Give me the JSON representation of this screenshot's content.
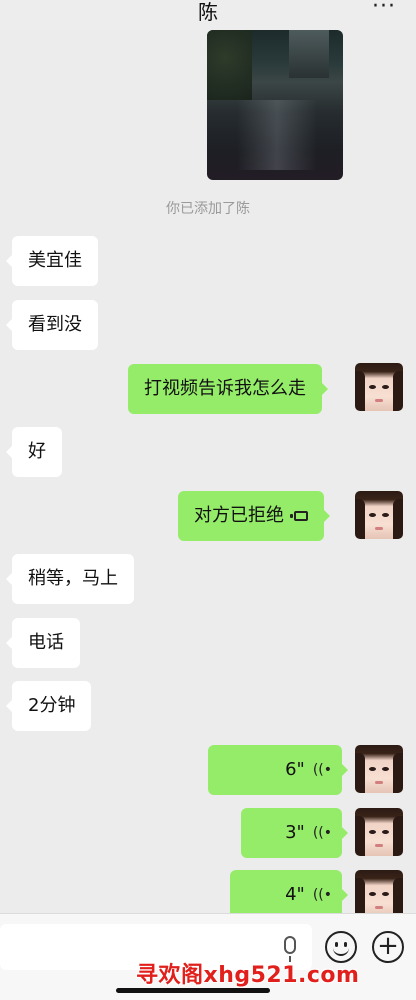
{
  "header": {
    "title": "陈",
    "more_label": "···"
  },
  "system_message": "你已添加了陈",
  "messages": {
    "m1": {
      "text": "美宜佳"
    },
    "m2": {
      "text": "看到没"
    },
    "m3": {
      "text": "打视频告诉我怎么走"
    },
    "m4": {
      "text": "好"
    },
    "m5": {
      "text": "对方已拒绝"
    },
    "m6": {
      "text": "稍等，马上"
    },
    "m7": {
      "text": "电话"
    },
    "m8": {
      "text": "2分钟"
    },
    "v1": {
      "duration": "6\""
    },
    "v2": {
      "duration": "3\""
    },
    "v3": {
      "duration": "4\""
    }
  },
  "voice_wave_symbol": "((•",
  "bottombar": {
    "plus_label": "+"
  },
  "watermark": "寻欢阁xhg521.com",
  "colors": {
    "outgoing": "#95ec69",
    "incoming": "#ffffff",
    "background": "#ececec",
    "watermark": "#e1201c"
  }
}
